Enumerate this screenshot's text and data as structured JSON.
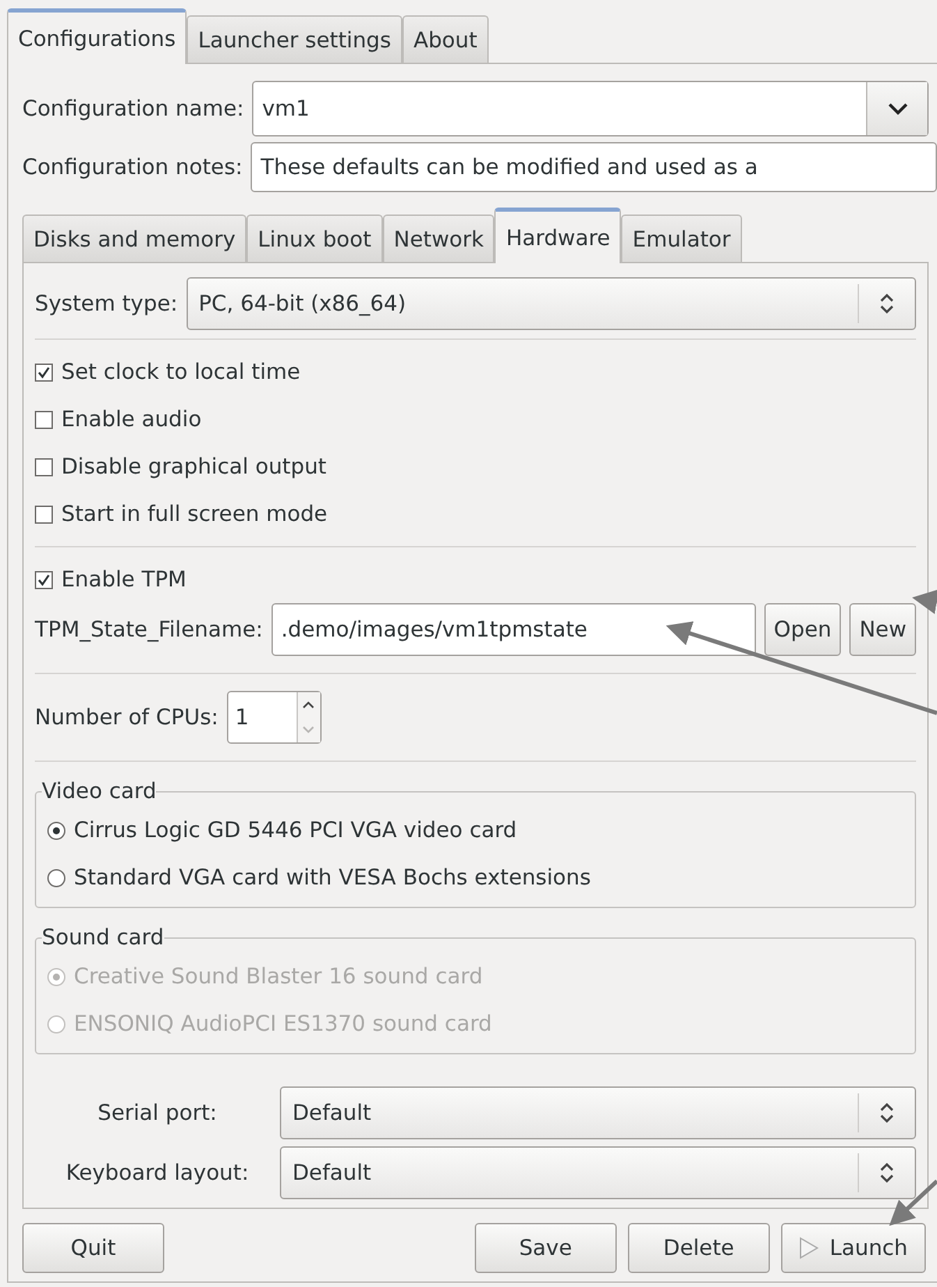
{
  "tabs": [
    {
      "label": "Configurations",
      "selected": true
    },
    {
      "label": "Launcher settings",
      "selected": false
    },
    {
      "label": "About",
      "selected": false
    }
  ],
  "config_name": {
    "label": "Configuration name:",
    "value": "vm1"
  },
  "config_notes": {
    "label": "Configuration notes:",
    "value": "These defaults can be modified and used as a"
  },
  "inner_tabs": [
    {
      "label": "Disks and memory",
      "selected": false
    },
    {
      "label": "Linux boot",
      "selected": false
    },
    {
      "label": "Network",
      "selected": false
    },
    {
      "label": "Hardware",
      "selected": true
    },
    {
      "label": "Emulator",
      "selected": false
    }
  ],
  "hardware": {
    "system_type": {
      "label": "System type:",
      "value": "PC, 64-bit (x86_64)"
    },
    "checkboxes": [
      {
        "label": "Set clock to local time",
        "checked": true
      },
      {
        "label": "Enable audio",
        "checked": false
      },
      {
        "label": "Disable graphical output",
        "checked": false
      },
      {
        "label": "Start in full screen mode",
        "checked": false
      }
    ],
    "tpm": {
      "label": "Enable TPM",
      "checked": true
    },
    "tpm_file": {
      "label": "TPM_State_Filename:",
      "value": ".demo/images/vm1tpmstate",
      "buttons": [
        "Open",
        "New"
      ]
    },
    "cpus": {
      "label": "Number of CPUs:",
      "value": "1"
    },
    "video_card": {
      "title": "Video card",
      "options": [
        {
          "label": "Cirrus Logic GD 5446 PCI VGA video card",
          "selected": true,
          "disabled": false
        },
        {
          "label": "Standard VGA card with VESA Bochs extensions",
          "selected": false,
          "disabled": false
        }
      ]
    },
    "sound_card": {
      "title": "Sound card",
      "options": [
        {
          "label": "Creative Sound Blaster 16 sound card",
          "selected": true,
          "disabled": true
        },
        {
          "label": "ENSONIQ AudioPCI ES1370 sound card",
          "selected": false,
          "disabled": true
        }
      ]
    },
    "serial_port": {
      "label": "Serial port:",
      "value": "Default"
    },
    "keyboard_layout": {
      "label": "Keyboard layout:",
      "value": "Default"
    }
  },
  "buttons": [
    {
      "label": "Quit",
      "kind": "plain"
    },
    {
      "label": "Save",
      "kind": "plain"
    },
    {
      "label": "Delete",
      "kind": "plain"
    },
    {
      "label": "Launch",
      "kind": "play"
    }
  ]
}
